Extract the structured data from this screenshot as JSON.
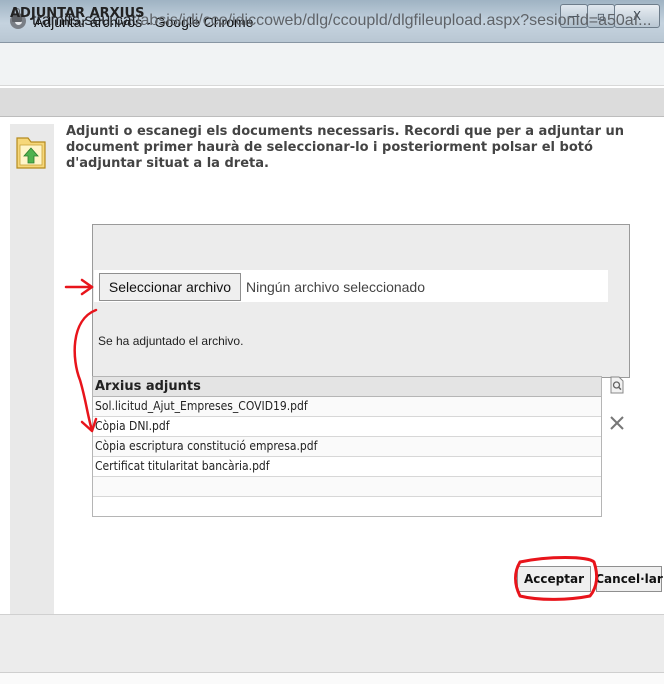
{
  "window": {
    "title": "Adjuntar archivos - Google Chrome",
    "minimize_glyph": "—",
    "maximize_glyph": "▫",
    "close_glyph": "X"
  },
  "address_bar": {
    "host": "tramits.seu.cat",
    "path": "/absis/idi/cco/idiccoweb/dlg/ccoupld/dlgfileupload.aspx?sesionId=a50af..."
  },
  "dialog": {
    "header": "ADJUNTAR ARXIUS",
    "instructions": "Adjunti o escanegi els documents necessaris. Recordi que per a adjuntar un document primer haurà de seleccionar-lo i posteriorment polsar el botó d'adjuntar situat a la dreta.",
    "file_input": {
      "button_label": "Seleccionar archivo",
      "status": "Ningún archivo seleccionado"
    },
    "attached_message": "Se ha adjuntado el archivo.",
    "table": {
      "header": "Arxius adjunts",
      "rows": [
        "Sol.licitud_Ajut_Empreses_COVID19.pdf",
        "Còpia DNI.pdf",
        "Còpia escriptura constitució empresa.pdf",
        "Certificat titularitat bancària.pdf",
        "",
        ""
      ]
    },
    "buttons": {
      "accept": "Acceptar",
      "cancel": "Cancel·lar"
    }
  },
  "icons": {
    "view": "view-document-icon",
    "delete": "delete-x-icon",
    "folder": "folder-upload-icon"
  },
  "colors": {
    "annotation_red": "#e8141b",
    "titlebar": "#b9c7d3"
  }
}
